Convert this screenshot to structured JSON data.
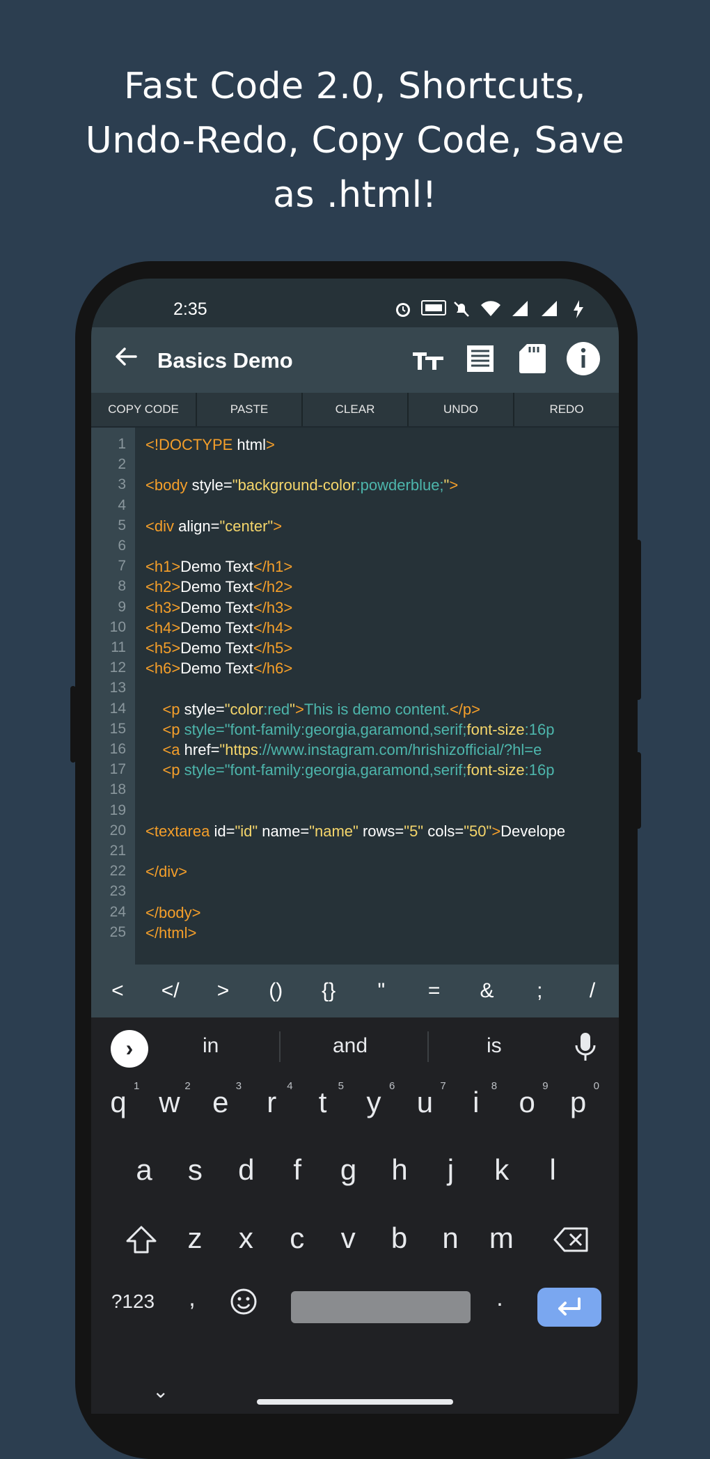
{
  "promo": {
    "line1": "Fast Code 2.0, Shortcuts,",
    "line2": "Undo-Redo, Copy Code, Save",
    "line3": "as .html!"
  },
  "status": {
    "time": "2:35",
    "icons": [
      "alarm-icon",
      "hd-icon",
      "mute-icon",
      "wifi-icon",
      "signal-icon",
      "signal-x-icon",
      "charging-icon"
    ]
  },
  "toolbar": {
    "title": "Basics Demo",
    "icons": [
      "text-size-icon",
      "document-icon",
      "sd-card-icon",
      "info-icon"
    ]
  },
  "actions": [
    "COPY CODE",
    "PASTE",
    "CLEAR",
    "UNDO",
    "REDO"
  ],
  "editor": {
    "line_numbers": [
      "1",
      "2",
      "3",
      "4",
      "5",
      "6",
      "7",
      "8",
      "9",
      "10",
      "11",
      "12",
      "13",
      "14",
      "15",
      "16",
      "17",
      "18",
      "19",
      "20",
      "21",
      "22",
      "23",
      "24",
      "25"
    ],
    "lines": [
      [
        [
          "t",
          "<!DOCTYPE "
        ],
        [
          "w",
          "html"
        ],
        [
          "t",
          ">"
        ]
      ],
      [],
      [
        [
          "t",
          "<body "
        ],
        [
          "w",
          "style="
        ],
        [
          "s",
          "\"background-color"
        ],
        [
          "c",
          ":powderblue;"
        ],
        [
          "s",
          "\""
        ],
        [
          "t",
          ">"
        ]
      ],
      [],
      [
        [
          "t",
          "<div "
        ],
        [
          "w",
          "align="
        ],
        [
          "s",
          "\"center\""
        ],
        [
          "t",
          ">"
        ]
      ],
      [],
      [
        [
          "t",
          "<h1>"
        ],
        [
          "w",
          "Demo Text"
        ],
        [
          "t",
          "</h1>"
        ]
      ],
      [
        [
          "t",
          "<h2>"
        ],
        [
          "w",
          "Demo Text"
        ],
        [
          "t",
          "</h2>"
        ]
      ],
      [
        [
          "t",
          "<h3>"
        ],
        [
          "w",
          "Demo Text"
        ],
        [
          "t",
          "</h3>"
        ]
      ],
      [
        [
          "t",
          "<h4>"
        ],
        [
          "w",
          "Demo Text"
        ],
        [
          "t",
          "</h4>"
        ]
      ],
      [
        [
          "t",
          "<h5>"
        ],
        [
          "w",
          "Demo Text"
        ],
        [
          "t",
          "</h5>"
        ]
      ],
      [
        [
          "t",
          "<h6>"
        ],
        [
          "w",
          "Demo Text"
        ],
        [
          "t",
          "</h6>"
        ]
      ],
      [],
      [
        [
          "w",
          "    "
        ],
        [
          "t",
          "<p "
        ],
        [
          "w",
          "style="
        ],
        [
          "s",
          "\"color"
        ],
        [
          "c",
          ":red"
        ],
        [
          "s",
          "\""
        ],
        [
          "t",
          ">"
        ],
        [
          "c",
          "This is demo content."
        ],
        [
          "t",
          "</p>"
        ]
      ],
      [
        [
          "w",
          "    "
        ],
        [
          "t",
          "<p "
        ],
        [
          "c",
          "style=\"font-family:georgia,garamond,serif;"
        ],
        [
          "s",
          "font-size"
        ],
        [
          "c",
          ":16p"
        ]
      ],
      [
        [
          "w",
          "    "
        ],
        [
          "t",
          "<a "
        ],
        [
          "w",
          "href="
        ],
        [
          "s",
          "\"https"
        ],
        [
          "c",
          "://www.instagram.com/hrishizofficial/?hl=e"
        ]
      ],
      [
        [
          "w",
          "    "
        ],
        [
          "t",
          "<p "
        ],
        [
          "c",
          "style=\"font-family:georgia,garamond,serif;"
        ],
        [
          "s",
          "font-size"
        ],
        [
          "c",
          ":16p"
        ]
      ],
      [],
      [],
      [
        [
          "t",
          "<textarea "
        ],
        [
          "w",
          "id="
        ],
        [
          "s",
          "\"id\""
        ],
        [
          "w",
          " name="
        ],
        [
          "s",
          "\"name\""
        ],
        [
          "w",
          " rows="
        ],
        [
          "s",
          "\"5\""
        ],
        [
          "w",
          " cols="
        ],
        [
          "s",
          "\"50\""
        ],
        [
          "t",
          ">"
        ],
        [
          "w",
          "Develope"
        ]
      ],
      [],
      [
        [
          "t",
          "</div>"
        ]
      ],
      [],
      [
        [
          "t",
          "</body>"
        ]
      ],
      [
        [
          "t",
          "</html>"
        ]
      ]
    ]
  },
  "shortcuts": [
    "<",
    "</",
    ">",
    "()",
    "{}",
    "\"",
    "=",
    "&",
    ";",
    "/"
  ],
  "keyboard": {
    "suggestions": [
      "in",
      "and",
      "is"
    ],
    "row1": [
      "q",
      "w",
      "e",
      "r",
      "t",
      "y",
      "u",
      "i",
      "o",
      "p"
    ],
    "row1_sup": [
      "1",
      "2",
      "3",
      "4",
      "5",
      "6",
      "7",
      "8",
      "9",
      "0"
    ],
    "row2": [
      "a",
      "s",
      "d",
      "f",
      "g",
      "h",
      "j",
      "k",
      "l"
    ],
    "row3": [
      "z",
      "x",
      "c",
      "v",
      "b",
      "n",
      "m"
    ],
    "row4": {
      "symbols": "?123",
      "comma": ",",
      "period": "."
    }
  }
}
